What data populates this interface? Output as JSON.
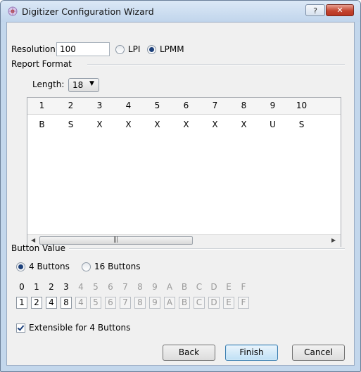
{
  "window": {
    "title": "Digitizer Configuration Wizard",
    "help_label": "?",
    "close_label": "✕"
  },
  "resolution": {
    "label": "Resolution:",
    "value": "100",
    "units": [
      {
        "label": "LPI",
        "checked": false
      },
      {
        "label": "LPMM",
        "checked": true
      }
    ]
  },
  "report_format": {
    "group_label": "Report Format",
    "length_label": "Length:",
    "length_value": "18",
    "columns": [
      "1",
      "2",
      "3",
      "4",
      "5",
      "6",
      "7",
      "8",
      "9",
      "10"
    ],
    "row": [
      "B",
      "S",
      "X",
      "X",
      "X",
      "X",
      "X",
      "X",
      "U",
      "S"
    ]
  },
  "button_value": {
    "group_label": "Button Value",
    "options": [
      {
        "label": "4 Buttons",
        "checked": true
      },
      {
        "label": "16 Buttons",
        "checked": false
      }
    ],
    "headers": [
      "0",
      "1",
      "2",
      "3",
      "4",
      "5",
      "6",
      "7",
      "8",
      "9",
      "A",
      "B",
      "C",
      "D",
      "E",
      "F"
    ],
    "values": [
      "1",
      "2",
      "4",
      "8",
      "4",
      "5",
      "6",
      "7",
      "8",
      "9",
      "A",
      "B",
      "C",
      "D",
      "E",
      "F"
    ],
    "enabled_count": 4
  },
  "extensible": {
    "label": "Extensible for 4 Buttons",
    "checked": true
  },
  "buttons": {
    "back": "Back",
    "finish": "Finish",
    "cancel": "Cancel"
  }
}
